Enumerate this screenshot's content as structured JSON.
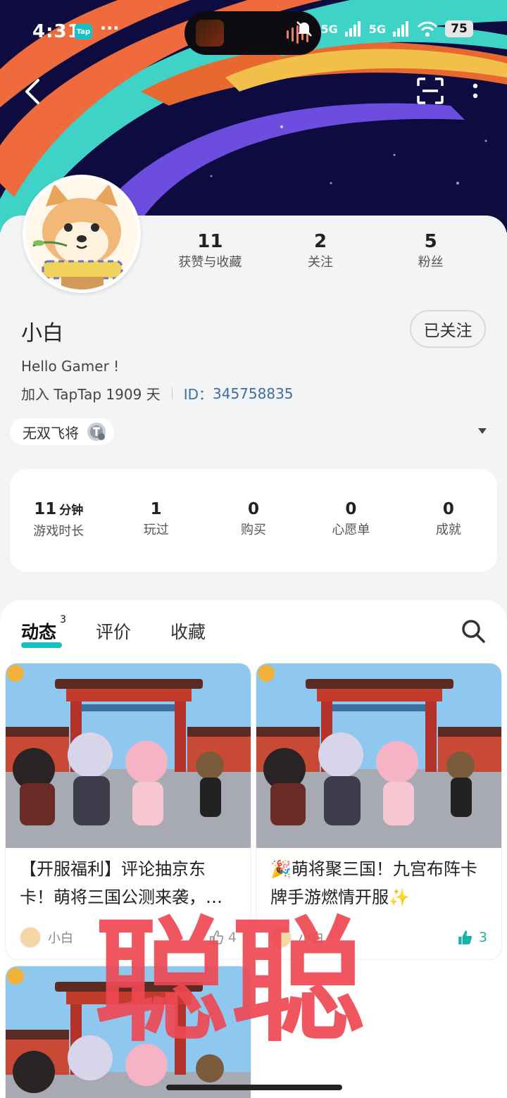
{
  "status_bar": {
    "time": "4:31",
    "app_chip": "Tap",
    "more": "···",
    "network": "5G",
    "battery": "75"
  },
  "profile": {
    "name": "小白",
    "follow_button": "已关注",
    "bio": "Hello Gamer !",
    "joined": "加入 TapTap 1909 天",
    "id_label": "ID：",
    "id_value": "345758835",
    "stats": [
      {
        "value": "11",
        "label": "获赞与收藏"
      },
      {
        "value": "2",
        "label": "关注"
      },
      {
        "value": "5",
        "label": "粉丝"
      }
    ],
    "game_chip": "无双飞将"
  },
  "play_stats": [
    {
      "value": "11",
      "unit": "分钟",
      "label": "游戏时长"
    },
    {
      "value": "1",
      "unit": "",
      "label": "玩过"
    },
    {
      "value": "0",
      "unit": "",
      "label": "购买"
    },
    {
      "value": "0",
      "unit": "",
      "label": "心愿单"
    },
    {
      "value": "0",
      "unit": "",
      "label": "成就"
    }
  ],
  "tabs": [
    {
      "label": "动态",
      "count": "3"
    },
    {
      "label": "评价"
    },
    {
      "label": "收藏"
    }
  ],
  "posts": [
    {
      "title": "【开服福利】评论抽京东卡！萌将三国公测来袭，…",
      "user": "小白",
      "likes": "4"
    },
    {
      "title": "🎉萌将聚三国！九宫布阵卡牌手游燃情开服✨",
      "user": "小白",
      "likes": "3"
    }
  ],
  "watermark": "聪聪",
  "colors": {
    "accent": "#14c3c0",
    "id_link": "#3a6ea5",
    "watermark": "#ee4852"
  }
}
